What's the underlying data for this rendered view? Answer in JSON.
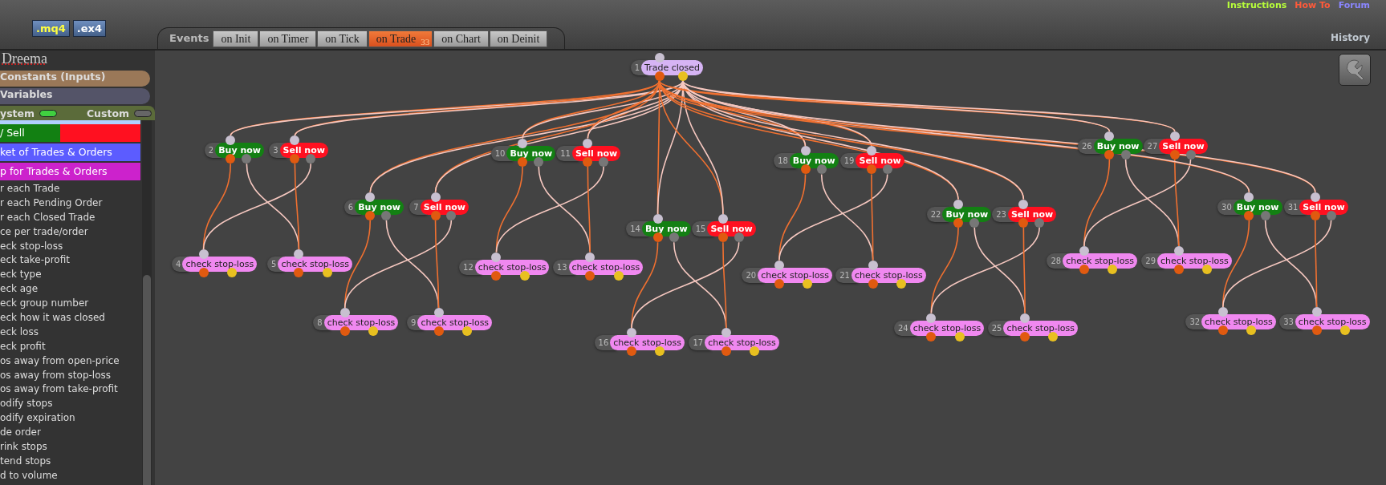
{
  "header": {
    "file_buttons": [
      ".mq4",
      ".ex4"
    ],
    "links": [
      {
        "label": "Instructions",
        "color": "#b8ff3a"
      },
      {
        "label": "How To",
        "color": "#ff5a3a"
      },
      {
        "label": "Forum",
        "color": "#8a86ff"
      }
    ],
    "history": "History"
  },
  "tabs": {
    "label": "Events",
    "items": [
      {
        "label": "on Init",
        "selected": false
      },
      {
        "label": "on Timer",
        "selected": false
      },
      {
        "label": "on Tick",
        "selected": false
      },
      {
        "label": "on Trade",
        "selected": true,
        "badge": "33"
      },
      {
        "label": "on Chart",
        "selected": false
      },
      {
        "label": "on Deinit",
        "selected": false
      }
    ]
  },
  "sidebar": {
    "title": "Dreema",
    "sections": [
      {
        "label": "Constants (Inputs)",
        "color": "#9a7858"
      },
      {
        "label": "Variables",
        "color": "#545468"
      }
    ],
    "filters": [
      {
        "label": "ystem",
        "on": true
      },
      {
        "label": "Custom",
        "on": false
      }
    ],
    "categories": [
      {
        "label": "/ Sell",
        "segments": [
          {
            "color": "#128012"
          },
          {
            "color": "#ff1020"
          }
        ]
      },
      {
        "label": "ket of Trades & Orders",
        "segments": [
          {
            "color": "#5c5cff"
          }
        ]
      },
      {
        "label": "p for Trades & Orders",
        "segments": [
          {
            "color": "#cc22cc"
          }
        ]
      }
    ],
    "items": [
      "r each Trade",
      "r each Pending Order",
      "r each Closed Trade",
      "ce per trade/order",
      "eck stop-loss",
      "eck take-profit",
      "eck type",
      "eck age",
      "eck group number",
      "eck how it was closed",
      "eck loss",
      "eck profit",
      "os away from open-price",
      "os away from stop-loss",
      "os away from take-profit",
      "odify stops",
      "odify expiration",
      "de order",
      "rink stops",
      "tend stops",
      "d to volume"
    ]
  },
  "canvas": {
    "root": {
      "number": "1",
      "label": "Trade closed"
    },
    "groups": [
      {
        "buy": {
          "number": "2",
          "label": "Buy now"
        },
        "sell": {
          "number": "3",
          "label": "Sell now"
        },
        "checks": [
          {
            "number": "4",
            "label": "check stop-loss"
          },
          {
            "number": "5",
            "label": "check stop-loss"
          }
        ]
      },
      {
        "buy": {
          "number": "6",
          "label": "Buy now"
        },
        "sell": {
          "number": "7",
          "label": "Sell now"
        },
        "checks": [
          {
            "number": "8",
            "label": "check stop-loss"
          },
          {
            "number": "9",
            "label": "check stop-loss"
          }
        ]
      },
      {
        "buy": {
          "number": "10",
          "label": "Buy now"
        },
        "sell": {
          "number": "11",
          "label": "Sell now"
        },
        "checks": [
          {
            "number": "12",
            "label": "check stop-loss"
          },
          {
            "number": "13",
            "label": "check stop-loss"
          }
        ]
      },
      {
        "buy": {
          "number": "14",
          "label": "Buy now"
        },
        "sell": {
          "number": "15",
          "label": "Sell now"
        },
        "checks": [
          {
            "number": "16",
            "label": "check stop-loss"
          },
          {
            "number": "17",
            "label": "check stop-loss"
          }
        ]
      },
      {
        "buy": {
          "number": "18",
          "label": "Buy now"
        },
        "sell": {
          "number": "19",
          "label": "Sell now"
        },
        "checks": [
          {
            "number": "20",
            "label": "check stop-loss"
          },
          {
            "number": "21",
            "label": "check stop-loss"
          }
        ]
      },
      {
        "buy": {
          "number": "22",
          "label": "Buy now"
        },
        "sell": {
          "number": "23",
          "label": "Sell now"
        },
        "checks": [
          {
            "number": "24",
            "label": "check stop-loss"
          },
          {
            "number": "25",
            "label": "check stop-loss"
          }
        ]
      },
      {
        "buy": {
          "number": "26",
          "label": "Buy now"
        },
        "sell": {
          "number": "27",
          "label": "Sell now"
        },
        "checks": [
          {
            "number": "28",
            "label": "check stop-loss"
          },
          {
            "number": "29",
            "label": "check stop-loss"
          }
        ]
      },
      {
        "buy": {
          "number": "30",
          "label": "Buy now"
        },
        "sell": {
          "number": "31",
          "label": "Sell now"
        },
        "checks": [
          {
            "number": "32",
            "label": "check stop-loss"
          },
          {
            "number": "33",
            "label": "check stop-loss"
          }
        ]
      }
    ]
  }
}
